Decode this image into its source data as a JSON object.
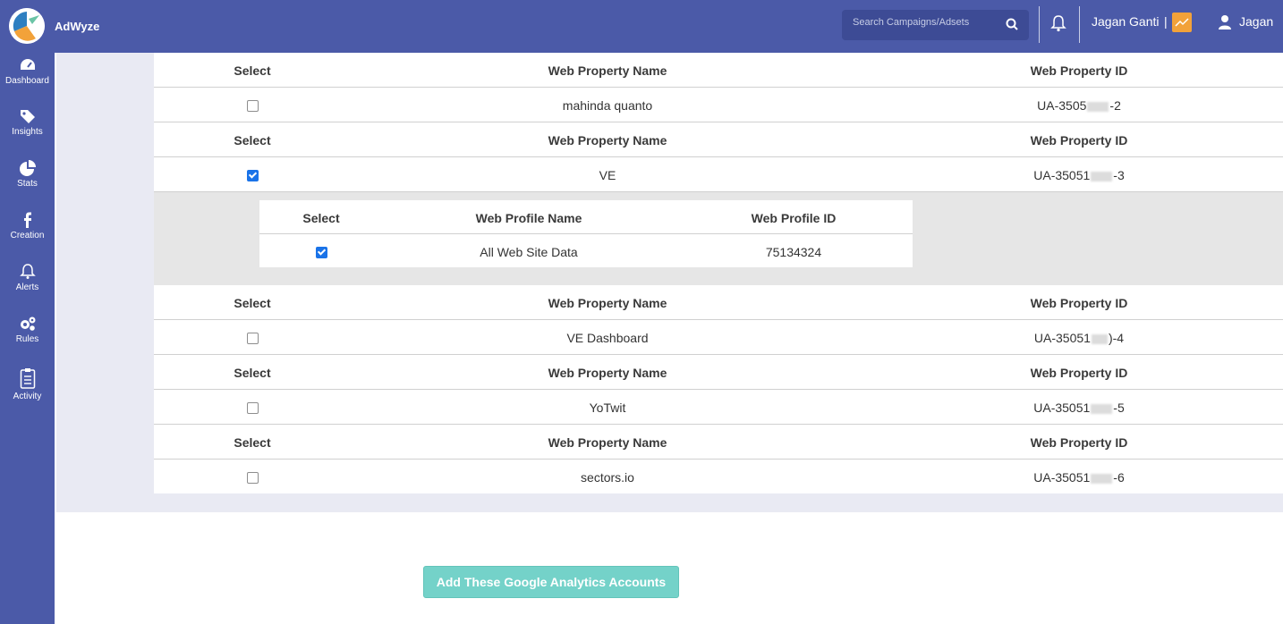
{
  "app": {
    "brand": "AdWyze"
  },
  "header": {
    "search_placeholder": "Search Campaigns/Adsets",
    "user_name": "Jagan Ganti",
    "separator": "|",
    "account_name": "Jagan"
  },
  "sidebar": {
    "items": [
      {
        "label": "Dashboard",
        "icon": "dashboard-icon"
      },
      {
        "label": "Insights",
        "icon": "tags-icon"
      },
      {
        "label": "Stats",
        "icon": "pie-chart-icon"
      },
      {
        "label": "Creation",
        "icon": "facebook-icon"
      },
      {
        "label": "Alerts",
        "icon": "bell-icon"
      },
      {
        "label": "Rules",
        "icon": "gears-icon"
      },
      {
        "label": "Activity",
        "icon": "clipboard-icon"
      }
    ]
  },
  "table": {
    "headers": {
      "select": "Select",
      "name": "Web Property Name",
      "id": "Web Property ID"
    },
    "properties": [
      {
        "name": "mahinda quanto",
        "id_prefix": "UA-3505",
        "id_suffix": "-2",
        "checked": false
      },
      {
        "name": "VE",
        "id_prefix": "UA-35051",
        "id_suffix": "-3",
        "checked": true
      },
      {
        "name": "VE Dashboard",
        "id_prefix": "UA-35051",
        "id_suffix": ")-4",
        "checked": false
      },
      {
        "name": "YoTwit",
        "id_prefix": "UA-35051",
        "id_suffix": "-5",
        "checked": false
      },
      {
        "name": "sectors.io",
        "id_prefix": "UA-35051",
        "id_suffix": "-6",
        "checked": false
      }
    ],
    "profile_table": {
      "headers": {
        "select": "Select",
        "name": "Web Profile Name",
        "id": "Web Profile ID"
      },
      "rows": [
        {
          "name": "All Web Site Data",
          "id": "75134324",
          "checked": true
        }
      ]
    }
  },
  "actions": {
    "add_button": "Add These Google Analytics Accounts"
  },
  "colors": {
    "primary": "#4b5aa8",
    "accent_button": "#74d2c9",
    "trend_badge": "#f2a23a",
    "checkbox": "#1a73e8"
  }
}
